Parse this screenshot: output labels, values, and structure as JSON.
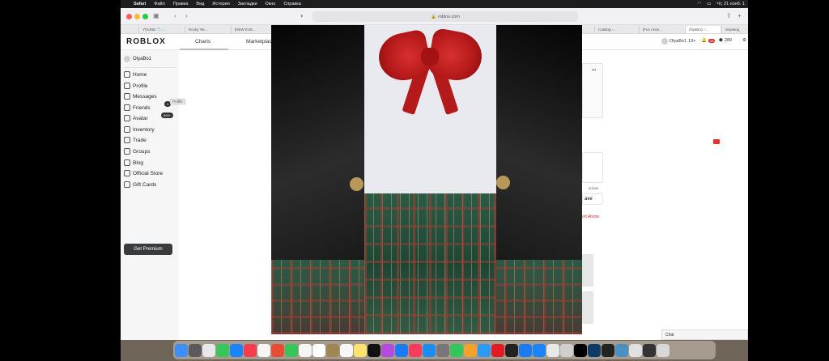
{
  "menubar": {
    "items": [
      "Safari",
      "Файл",
      "Правка",
      "Вид",
      "История",
      "Закладки",
      "Окно",
      "Справка"
    ],
    "clock": "Чт, 21 нояб. 1"
  },
  "browser": {
    "url": "roblox.com",
    "tabs": [
      "YOUND 👕...",
      "Rocky Ter...",
      "[NEW EVE...",
      "Catalog -...",
      "[Fun Anim...",
      "OlyaBo1 -...",
      "перевод"
    ]
  },
  "header": {
    "logo": "ROBLOX",
    "nav_charts": "Charts",
    "nav_marketplace": "Marketplace",
    "username": "OlyaBo1",
    "age": "13+",
    "notifications": "10",
    "robux": "280"
  },
  "sidebar": {
    "username": "OlyaBo1",
    "items": [
      {
        "label": "Home",
        "icon": "home-icon"
      },
      {
        "label": "Profile",
        "icon": "profile-icon"
      },
      {
        "label": "Messages",
        "icon": "messages-icon",
        "badge": "1"
      },
      {
        "label": "Friends",
        "icon": "friends-icon",
        "badge": "500+"
      },
      {
        "label": "Avatar",
        "icon": "avatar-icon"
      },
      {
        "label": "Inventory",
        "icon": "inventory-icon"
      },
      {
        "label": "Trade",
        "icon": "trade-icon"
      },
      {
        "label": "Groups",
        "icon": "groups-icon"
      },
      {
        "label": "Blog",
        "icon": "blog-icon"
      },
      {
        "label": "Official Store",
        "icon": "store-icon"
      },
      {
        "label": "Gift Cards",
        "icon": "gift-icon"
      }
    ],
    "tooltip": "Profile",
    "premium_button": "Get Premium"
  },
  "main": {
    "more": "•••",
    "counter": "0/1000",
    "save_fragment": "ave",
    "report_fragment": "ort Abuse"
  },
  "chat": {
    "label": "Chat"
  }
}
